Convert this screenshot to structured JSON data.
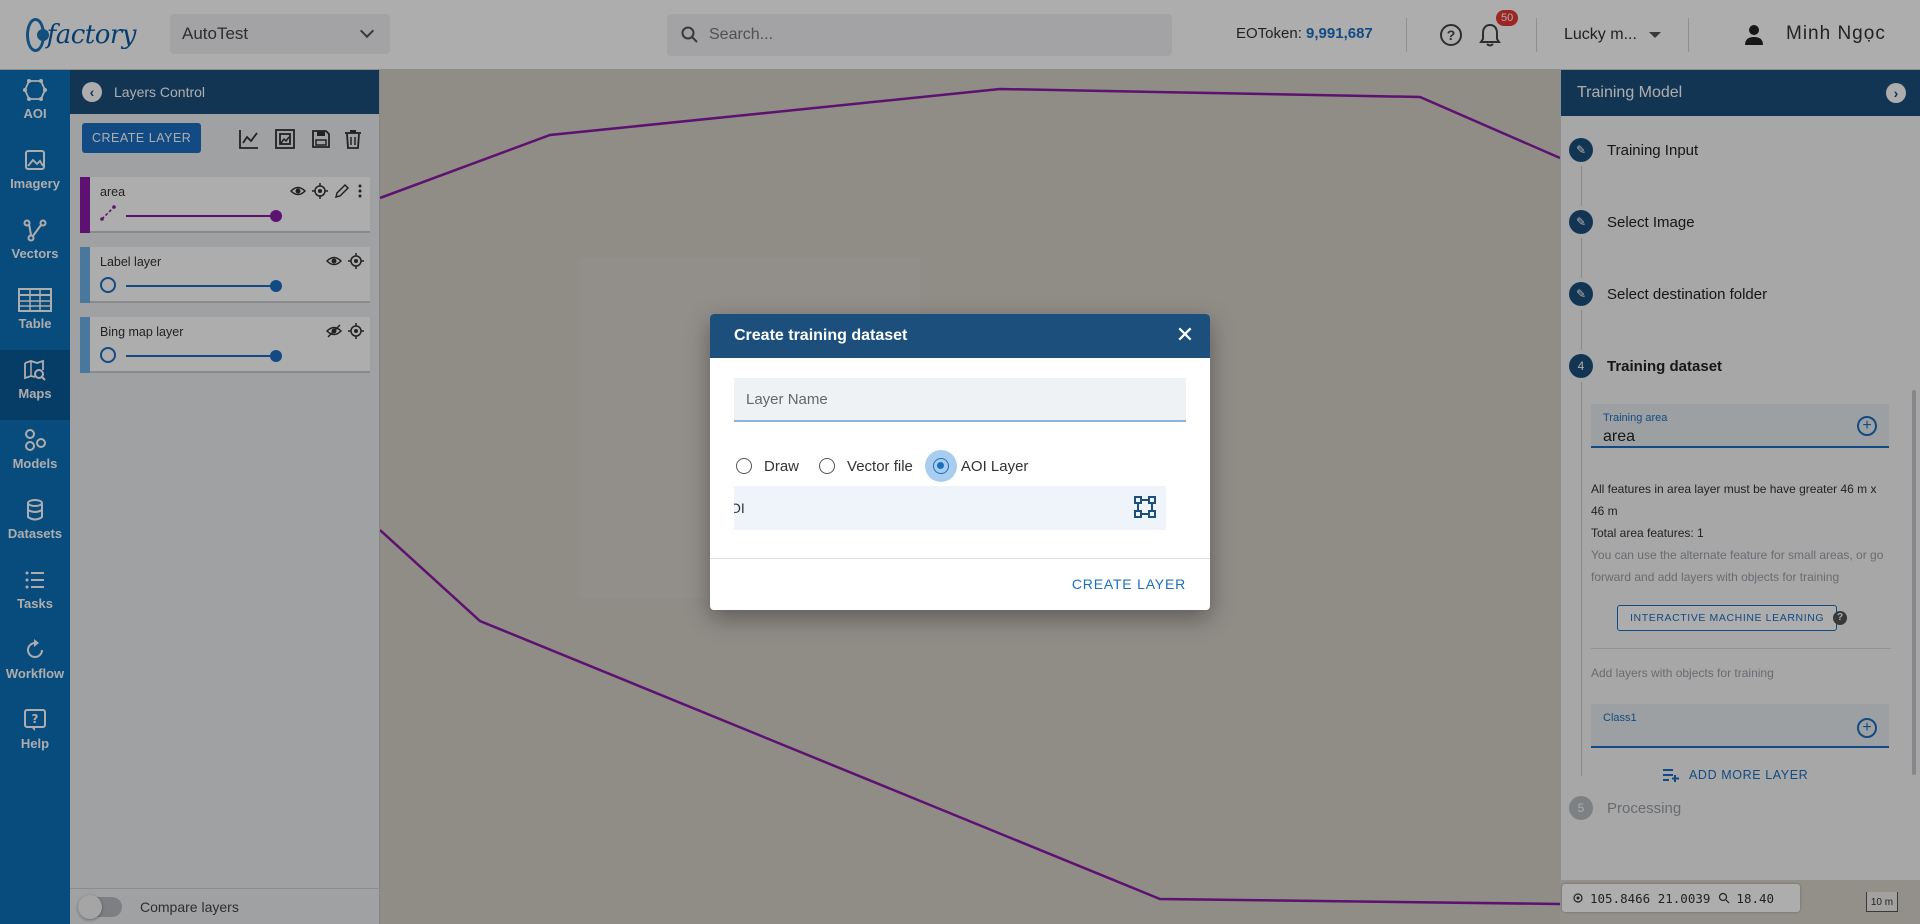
{
  "app": {
    "logo_text": "factory",
    "project": "AutoTest",
    "search_placeholder": "Search...",
    "token_label": "EOToken:",
    "token_value": "9,991,687",
    "notification_count": "50",
    "organization": "Lucky m...",
    "user_name": "Minh Ngọc"
  },
  "nav": [
    {
      "label": "AOI",
      "icon": "aoi-polygon-icon"
    },
    {
      "label": "Imagery",
      "icon": "image-icon"
    },
    {
      "label": "Vectors",
      "icon": "vector-icon"
    },
    {
      "label": "Table",
      "icon": "table-icon"
    },
    {
      "label": "Maps",
      "icon": "map-search-icon"
    },
    {
      "label": "Models",
      "icon": "models-icon"
    },
    {
      "label": "Datasets",
      "icon": "database-icon"
    },
    {
      "label": "Tasks",
      "icon": "list-icon"
    },
    {
      "label": "Workflow",
      "icon": "workflow-icon"
    },
    {
      "label": "Help",
      "icon": "help-icon"
    }
  ],
  "layers_panel": {
    "title": "Layers Control",
    "create_label": "CREATE LAYER",
    "layers": [
      {
        "name": "area",
        "opacity": 0.95
      },
      {
        "name": "Label layer",
        "opacity": 0.95
      },
      {
        "name": "Bing map layer",
        "opacity": 0.95
      }
    ],
    "compare_label": "Compare layers"
  },
  "training": {
    "title": "Training Model",
    "steps": [
      {
        "label": "Training Input"
      },
      {
        "label": "Select Image"
      },
      {
        "label": "Select destination folder"
      },
      {
        "num": "4",
        "label": "Training dataset"
      },
      {
        "num": "5",
        "label": "Processing"
      }
    ],
    "area_label": "Training area",
    "area_value": "area",
    "info_line1": "All features in area layer must be have greater 46 m x 46 m",
    "info_line2": "Total area features: 1",
    "info_muted": "You can use the alternate feature for small areas, or go forward and add layers with objects for training",
    "iml_label": "INTERACTIVE MACHINE LEARNING",
    "add_layers_hint": "Add layers with objects for training",
    "class_label": "Class1",
    "add_more_label": "ADD MORE LAYER"
  },
  "coords": "105.8466 21.0039",
  "zoom": "18.40",
  "scale_label": "10 m",
  "dialog": {
    "title": "Create training dataset",
    "input_placeholder": "Layer Name",
    "radio_options": [
      "Draw",
      "Vector file",
      "AOI Layer"
    ],
    "selected_option": "AOI Layer",
    "aoi_value": "OI",
    "create_label": "CREATE LAYER"
  },
  "colors": {
    "nav_bg": "#0d6fb8",
    "header_bg": "#1d4f7d",
    "accent": "#1b6fc1",
    "polygon": "#8a1aa6"
  }
}
